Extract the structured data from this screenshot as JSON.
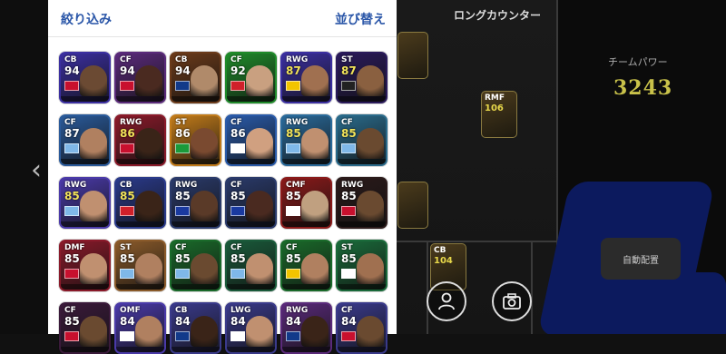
{
  "panel": {
    "filter_label": "絞り込み",
    "sort_label": "並び替え"
  },
  "formation": {
    "title": "ロングカウンター",
    "power_label": "チームパワー",
    "power_value": "3243",
    "auto_assign_label": "自動配置",
    "mini_cards": [
      {
        "pos": "RMF",
        "rating": "106"
      },
      {
        "pos": "CB",
        "rating": "104"
      }
    ]
  },
  "players": [
    {
      "pos": "CB",
      "rating": "94",
      "bg": "#3b2fa0",
      "face": "#6b4a33",
      "flag": "#c8102e"
    },
    {
      "pos": "CF",
      "rating": "94",
      "bg": "#5a2a7a",
      "face": "#4a2a20",
      "flag": "#c8102e"
    },
    {
      "pos": "CB",
      "rating": "94",
      "bg": "#6a3a1a",
      "face": "#b08a6a",
      "flag": "#123a8a"
    },
    {
      "pos": "CF",
      "rating": "92",
      "bg": "#1f8a2a",
      "face": "#c9a080",
      "flag": "#d0202a"
    },
    {
      "pos": "RWG",
      "rating": "87",
      "bg": "#3b2fa0",
      "face": "#a07050",
      "flag": "#f2c400"
    },
    {
      "pos": "ST",
      "rating": "87",
      "bg": "#2a1a5a",
      "face": "#8a6040",
      "flag": "#222222"
    },
    {
      "pos": "CF",
      "rating": "87",
      "bg": "#2a5a9a",
      "face": "#b08060",
      "flag": "#7fb8e8"
    },
    {
      "pos": "RWG",
      "rating": "86",
      "bg": "#8a1a2a",
      "face": "#3a2418",
      "flag": "#c8102e"
    },
    {
      "pos": "ST",
      "rating": "86",
      "bg": "#c07a1a",
      "face": "#7a4a30",
      "flag": "#1a9a3a"
    },
    {
      "pos": "CF",
      "rating": "86",
      "bg": "#2a5aa8",
      "face": "#d0a080",
      "flag": "#ffffff"
    },
    {
      "pos": "RWG",
      "rating": "85",
      "bg": "#2a6a9a",
      "face": "#c09070",
      "flag": "#7fb8e8"
    },
    {
      "pos": "CF",
      "rating": "85",
      "bg": "#2a6a8a",
      "face": "#6a4a30",
      "flag": "#7fb8e8"
    },
    {
      "pos": "RWG",
      "rating": "85",
      "bg": "#4a3aa8",
      "face": "#c09070",
      "flag": "#7fb8e8"
    },
    {
      "pos": "CB",
      "rating": "85",
      "bg": "#2a3a8a",
      "face": "#3a2418",
      "flag": "#d0202a"
    },
    {
      "pos": "RWG",
      "rating": "85",
      "bg": "#2a3a6a",
      "face": "#5a3a28",
      "flag": "#1a3aa0"
    },
    {
      "pos": "CF",
      "rating": "85",
      "bg": "#2a3a6a",
      "face": "#4a2a20",
      "flag": "#1a3aa0"
    },
    {
      "pos": "CMF",
      "rating": "85",
      "bg": "#8a1a1a",
      "face": "#c0a080",
      "flag": "#ffffff"
    },
    {
      "pos": "RWG",
      "rating": "85",
      "bg": "#2a1a1a",
      "face": "#6a4a30",
      "flag": "#c8102e"
    },
    {
      "pos": "DMF",
      "rating": "85",
      "bg": "#8a1a2a",
      "face": "#c09070",
      "flag": "#c8102e"
    },
    {
      "pos": "ST",
      "rating": "85",
      "bg": "#8a5a2a",
      "face": "#b08060",
      "flag": "#7fb8e8"
    },
    {
      "pos": "CF",
      "rating": "85",
      "bg": "#1a6a2a",
      "face": "#6a4a30",
      "flag": "#7fb8e8"
    },
    {
      "pos": "CF",
      "rating": "85",
      "bg": "#1a5a3a",
      "face": "#c09070",
      "flag": "#7fb8e8"
    },
    {
      "pos": "CF",
      "rating": "85",
      "bg": "#1a6a2a",
      "face": "#b08060",
      "flag": "#f2c400"
    },
    {
      "pos": "ST",
      "rating": "85",
      "bg": "#1a6a3a",
      "face": "#a07050",
      "flag": "#ffffff"
    },
    {
      "pos": "CF",
      "rating": "85",
      "bg": "#3a1a3a",
      "face": "#6a4a30",
      "flag": "#c8102e"
    },
    {
      "pos": "OMF",
      "rating": "84",
      "bg": "#4a3aa8",
      "face": "#b08060",
      "flag": "#ffffff"
    },
    {
      "pos": "CB",
      "rating": "84",
      "bg": "#3a3a8a",
      "face": "#3a2418",
      "flag": "#123a8a"
    },
    {
      "pos": "LWG",
      "rating": "84",
      "bg": "#3a3a8a",
      "face": "#c09070",
      "flag": "#ffffff"
    },
    {
      "pos": "RWG",
      "rating": "84",
      "bg": "#5a2a7a",
      "face": "#3a2418",
      "flag": "#123a8a"
    },
    {
      "pos": "CF",
      "rating": "84",
      "bg": "#3a3a8a",
      "face": "#6a4a30",
      "flag": "#c8102e"
    }
  ]
}
